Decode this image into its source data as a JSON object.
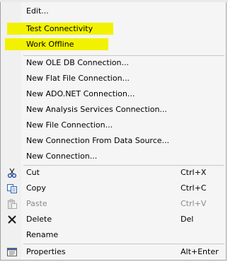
{
  "menu": {
    "edit": "Edit...",
    "test_connectivity": "Test Connectivity",
    "work_offline": "Work Offline",
    "new_oledb": "New OLE DB Connection...",
    "new_flat_file": "New Flat File Connection...",
    "new_adonet": "New ADO.NET Connection...",
    "new_analysis_services": "New Analysis Services Connection...",
    "new_file": "New File Connection...",
    "new_from_data_source": "New Connection From Data Source...",
    "new_connection": "New Connection...",
    "cut": "Cut",
    "cut_shortcut": "Ctrl+X",
    "copy": "Copy",
    "copy_shortcut": "Ctrl+C",
    "paste": "Paste",
    "paste_shortcut": "Ctrl+V",
    "delete": "Delete",
    "delete_shortcut": "Del",
    "rename": "Rename",
    "properties": "Properties",
    "properties_shortcut": "Alt+Enter"
  },
  "colors": {
    "highlight": "#f2f200",
    "menu_background": "#f5f5f5",
    "disabled_text": "#8a8a8a"
  },
  "icons": {
    "cut": "scissors-icon",
    "copy": "copy-icon",
    "paste": "paste-icon",
    "delete": "delete-x-icon",
    "properties": "properties-icon"
  }
}
